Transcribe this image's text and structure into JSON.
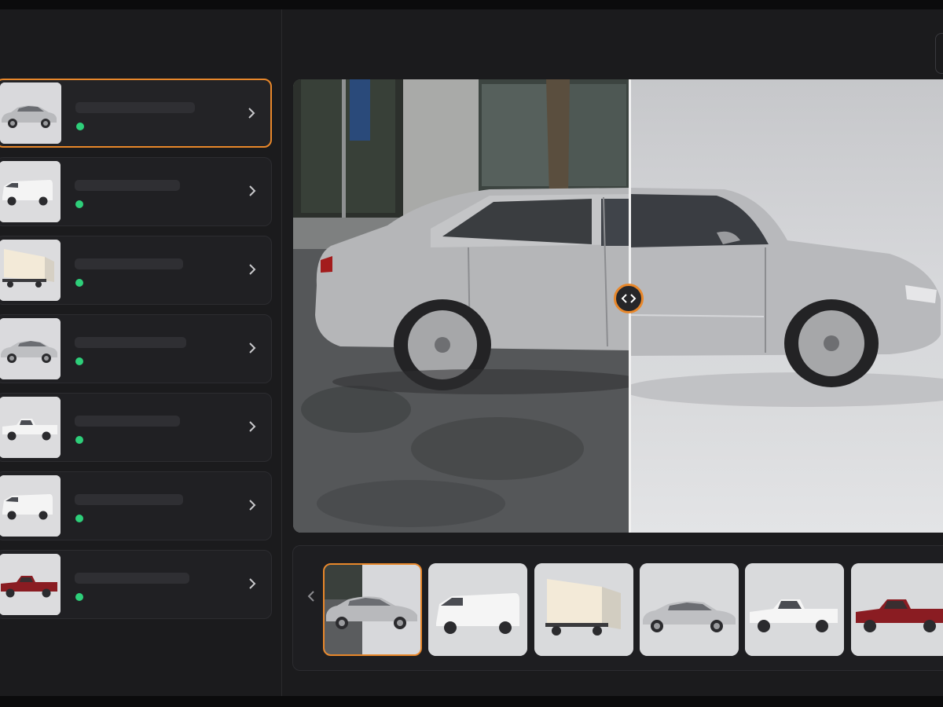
{
  "vehicles": [
    {
      "kind": "sedan-silver",
      "status": "ready",
      "selected": true
    },
    {
      "kind": "van-white",
      "status": "ready",
      "selected": false
    },
    {
      "kind": "box-truck",
      "status": "ready",
      "selected": false
    },
    {
      "kind": "sedan-silver",
      "status": "ready",
      "selected": false
    },
    {
      "kind": "pickup-white",
      "status": "ready",
      "selected": false
    },
    {
      "kind": "van-white",
      "status": "ready",
      "selected": false
    },
    {
      "kind": "pickup-red",
      "status": "ready",
      "selected": false
    }
  ],
  "viewer": {
    "split_fraction": 0.51
  },
  "filmstrip": {
    "thumbnails": [
      "sedan-silver",
      "van-white",
      "box-truck",
      "sedan-silver",
      "pickup-white",
      "pickup-red"
    ],
    "selected_index": 0
  },
  "colors": {
    "accent": "#e8872a",
    "status_ready": "#2ecf7a",
    "background": "#1b1b1d",
    "card": "#202023"
  },
  "icons": {
    "card_chevron": "chevron-right-icon",
    "compare_handle": "compare-arrows-icon",
    "filmstrip_prev": "chevron-left-icon"
  }
}
